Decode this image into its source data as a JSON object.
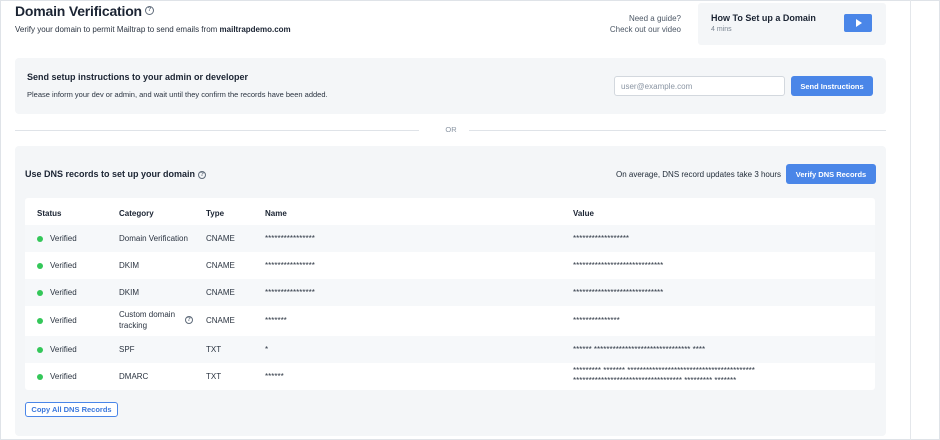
{
  "header": {
    "title": "Domain Verification",
    "subtitle_prefix": "Verify your domain to permit Mailtrap to send emails from ",
    "domain": "mailtrapdemo.com"
  },
  "guide": {
    "line1": "Need a guide?",
    "line2": "Check out our video"
  },
  "video_card": {
    "title": "How To Set up a Domain",
    "duration": "4 mins"
  },
  "admin_panel": {
    "title": "Send setup instructions to your admin or developer",
    "subtitle": "Please inform your dev or admin, and wait until they confirm the records have been added.",
    "email_placeholder": "user@example.com",
    "email_value": "",
    "send_label": "Send Instructions"
  },
  "divider": {
    "label": "OR"
  },
  "dns_panel": {
    "title": "Use DNS records to set up your domain",
    "avg_text": "On average, DNS record updates take 3 hours",
    "verify_label": "Verify DNS Records",
    "copy_label": "Copy All DNS Records",
    "status_color": "#34c759",
    "accent_color": "#4a86e8"
  },
  "table": {
    "columns": [
      "Status",
      "Category",
      "Type",
      "Name",
      "Value"
    ],
    "rows": [
      {
        "status": "Verified",
        "category": "Domain Verification",
        "type": "CNAME",
        "name": "****************",
        "value": "******************"
      },
      {
        "status": "Verified",
        "category": "DKIM",
        "type": "CNAME",
        "name": "****************",
        "value": "*****************************"
      },
      {
        "status": "Verified",
        "category": "DKIM",
        "type": "CNAME",
        "name": "****************",
        "value": "*****************************"
      },
      {
        "status": "Verified",
        "category": "Custom domain tracking",
        "category_line1": "Custom domain",
        "category_line2": "tracking",
        "type": "CNAME",
        "name": "*******",
        "value": "***************"
      },
      {
        "status": "Verified",
        "category": "SPF",
        "type": "TXT",
        "name": "*",
        "value": "****** ******************************* ****"
      },
      {
        "status": "Verified",
        "category": "DMARC",
        "type": "TXT",
        "name": "******",
        "value_line1": "********* ******* *****************************************",
        "value_line2": "*********************************** ********* *******"
      }
    ]
  }
}
